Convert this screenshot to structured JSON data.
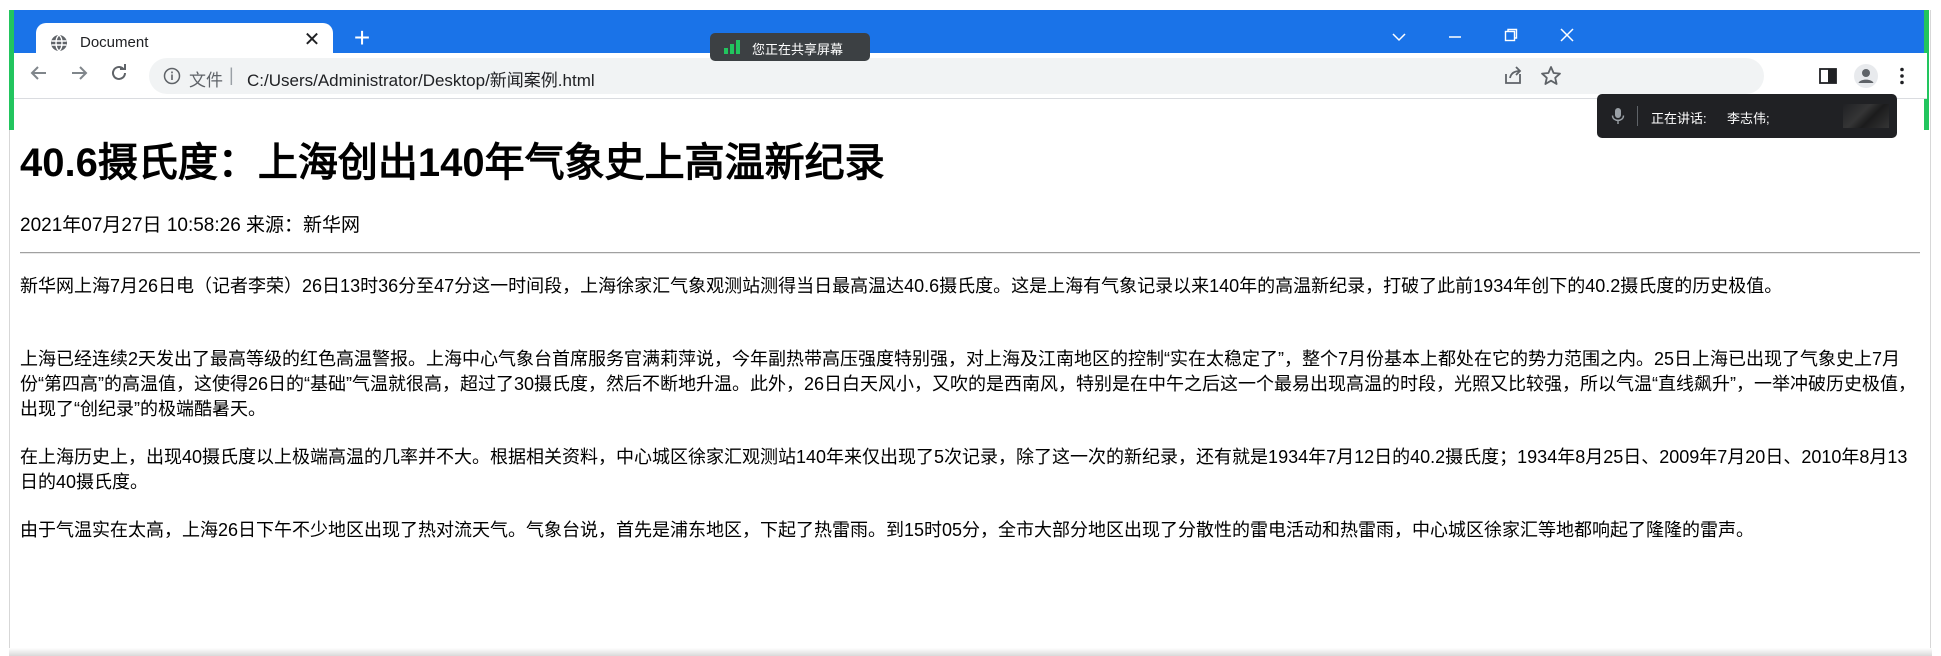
{
  "browser": {
    "tab_title": "Document",
    "tab_close_icon": "close-icon",
    "new_tab_icon": "plus-icon",
    "sharing_notice": "您正在共享屏幕",
    "window_controls": [
      "chevron-down-icon",
      "minimize-icon",
      "restore-icon",
      "close-icon"
    ]
  },
  "toolbar": {
    "url_scheme_label": "文件",
    "url_separator": "|",
    "url": "C:/Users/Administrator/Desktop/新闻案例.html",
    "icons": [
      "back-icon",
      "forward-icon",
      "reload-icon",
      "info-icon",
      "share-icon",
      "star-icon",
      "side-panel-icon",
      "profile-icon",
      "more-icon"
    ]
  },
  "speaking": {
    "label": "正在讲话:",
    "name": "李志伟;"
  },
  "article": {
    "title": "40.6摄氏度：上海创出140年气象史上高温新纪录",
    "meta": "2021年07月27日 10:58:26 来源：新华网",
    "paragraphs": [
      "新华网上海7月26日电（记者李荣）26日13时36分至47分这一时间段，上海徐家汇气象观测站测得当日最高温达40.6摄氏度。这是上海有气象记录以来140年的高温新纪录，打破了此前1934年创下的40.2摄氏度的历史极值。",
      "上海已经连续2天发出了最高等级的红色高温警报。上海中心气象台首席服务官满莉萍说，今年副热带高压强度特别强，对上海及江南地区的控制“实在太稳定了”，整个7月份基本上都处在它的势力范围之内。25日上海已出现了气象史上7月份“第四高”的高温值，这使得26日的“基础”气温就很高，超过了30摄氏度，然后不断地升温。此外，26日白天风小，又吹的是西南风，特别是在中午之后这一个最易出现高温的时段，光照又比较强，所以气温“直线飙升”，一举冲破历史极值，出现了“创纪录”的极端酷暑天。",
      "在上海历史上，出现40摄氏度以上极端高温的几率并不大。根据相关资料，中心城区徐家汇观测站140年来仅出现了5次记录，除了这一次的新纪录，还有就是1934年7月12日的40.2摄氏度；1934年8月25日、2009年7月20日、2010年8月13日的40摄氏度。",
      "由于气温实在太高，上海26日下午不少地区出现了热对流天气。气象台说，首先是浦东地区，下起了热雷雨。到15时05分，全市大部分地区出现了分散性的雷电活动和热雷雨，中心城区徐家汇等地都响起了隆隆的雷声。"
    ]
  },
  "colors": {
    "titlebar": "#1a73e8",
    "accent_green": "#22c55e",
    "popup_bg": "#202124"
  }
}
